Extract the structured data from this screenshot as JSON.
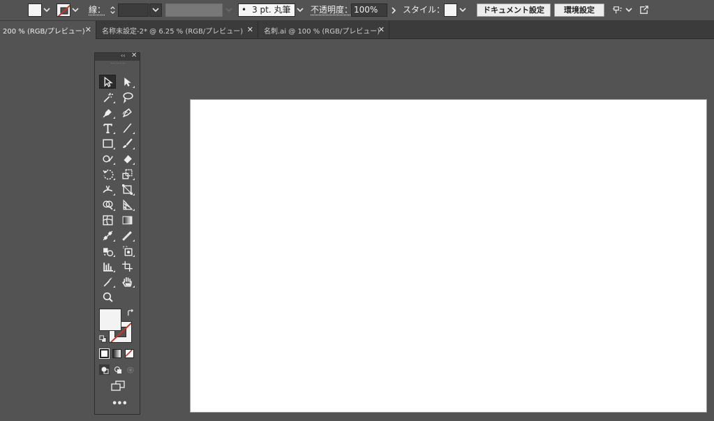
{
  "control_bar": {
    "stroke_label": "線：",
    "stroke_weight": "",
    "brush_definition": "3 pt. 丸筆",
    "brush_dot": "•",
    "opacity_label": "不透明度：",
    "opacity_value": "100%",
    "style_label": "スタイル：",
    "document_setup_button": "ドキュメント設定",
    "preferences_button": "環境設定"
  },
  "tabs": [
    {
      "label": "200 % (RGB/プレビュー)",
      "close": "✕",
      "active": true
    },
    {
      "label": "名称未設定-2* @ 6.25 % (RGB/プレビュー)",
      "close": "✕",
      "active": false
    },
    {
      "label": "名刺.ai @ 100 % (RGB/プレビュー)",
      "close": "✕",
      "active": false
    }
  ],
  "tools_panel": {
    "collapse_glyph": "‹‹",
    "close_glyph": "✕",
    "more_glyph": "•••",
    "tools": [
      "selection-tool",
      "direct-selection-tool",
      "magic-wand-tool",
      "lasso-tool",
      "pen-tool",
      "curvature-tool",
      "type-tool",
      "line-segment-tool",
      "rectangle-tool",
      "paintbrush-tool",
      "shaper-tool",
      "eraser-tool",
      "rotate-tool",
      "scale-tool",
      "width-tool",
      "free-transform-tool",
      "shape-builder-tool",
      "perspective-grid-tool",
      "mesh-tool",
      "gradient-tool",
      "blend-tool",
      "eyedropper-tool",
      "symbol-sprayer-tool",
      "artboard-slice-tool",
      "column-graph-tool",
      "artboard-tool",
      "knife-tool",
      "hand-tool",
      "zoom-tool"
    ],
    "fill_color": "#f3f3f3",
    "stroke_color": "none"
  },
  "colors": {
    "ui_background": "#535353",
    "artboard": "#ffffff",
    "none_slash": "#c0392b"
  }
}
